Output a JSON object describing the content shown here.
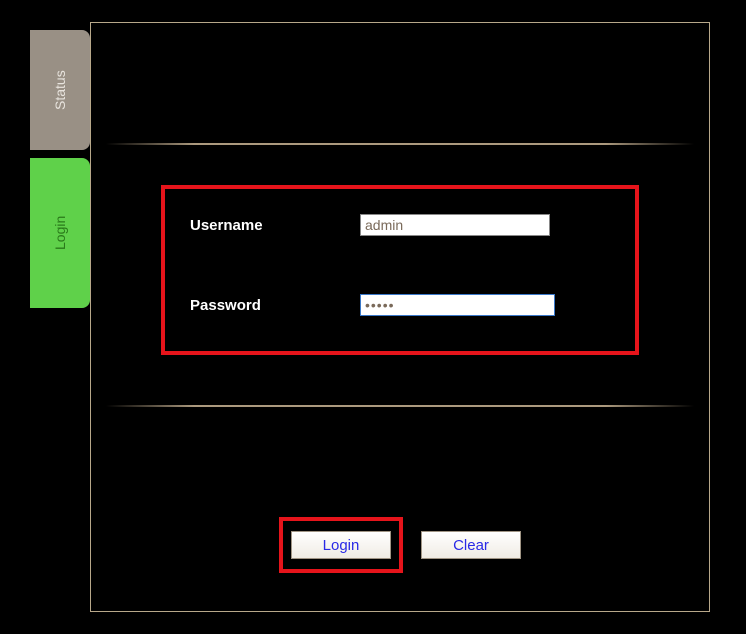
{
  "tabs": {
    "status": "Status",
    "login": "Login"
  },
  "form": {
    "username_label": "Username",
    "username_value": "admin",
    "password_label": "Password",
    "password_value": "•••••"
  },
  "buttons": {
    "login": "Login",
    "clear": "Clear"
  }
}
